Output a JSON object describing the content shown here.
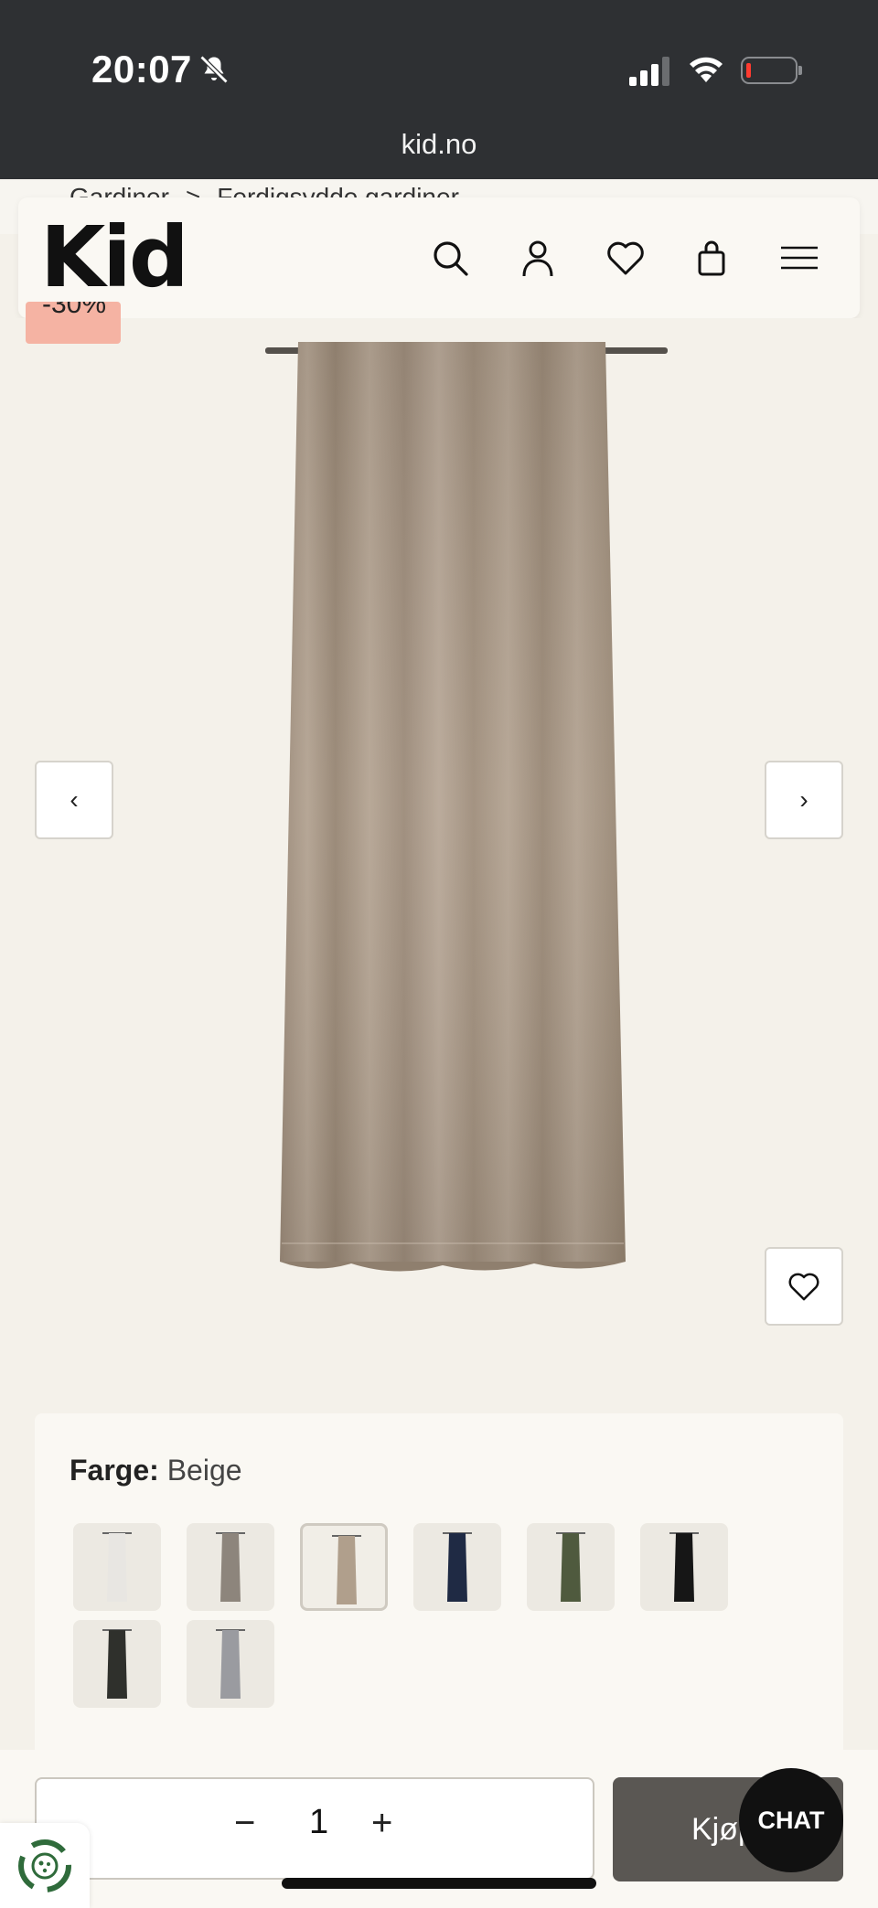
{
  "status_bar": {
    "time": "20:07",
    "url": "kid.no"
  },
  "breadcrumb": {
    "items": [
      "Gardiner",
      "Ferdigsydde gardiner"
    ],
    "separator": ">"
  },
  "header": {
    "logo": "Kid",
    "icons": [
      "search-icon",
      "account-icon",
      "heart-icon",
      "bag-icon",
      "menu-icon"
    ]
  },
  "product": {
    "discount_badge": "-30%",
    "prev_icon": "‹",
    "next_icon": "›",
    "color_label": "Farge:",
    "color_value": "Beige",
    "swatches": [
      {
        "color": "#e8e6e2"
      },
      {
        "color": "#8d857c"
      },
      {
        "color": "#b09f8c",
        "selected": true
      },
      {
        "color": "#1f2a44"
      },
      {
        "color": "#4f5a3e"
      },
      {
        "color": "#161616"
      },
      {
        "color": "#2f302c"
      },
      {
        "color": "#9a9ba0"
      }
    ],
    "curtain_color": "#a89887"
  },
  "bottom_bar": {
    "quantity": "1",
    "minus": "−",
    "plus": "+",
    "buy_label": "Kjøp",
    "chat_label": "CHAT"
  }
}
